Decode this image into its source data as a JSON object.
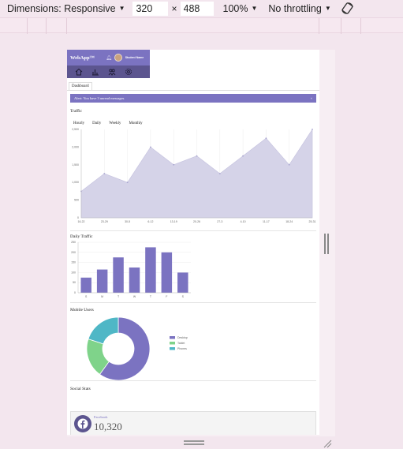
{
  "devtools": {
    "device": "Dimensions: Responsive",
    "width": "320",
    "times": "×",
    "height": "488",
    "zoom": "100%",
    "throttling": "No throttling"
  },
  "app": {
    "brand": "WebApp™",
    "user_name": "Student Name",
    "breadcrumb": "Dashboard",
    "alert_text": "Alert: You have 3 unread messages.",
    "alert_close": "×"
  },
  "traffic": {
    "title": "Traffic",
    "tabs": [
      "Hourly",
      "Daily",
      "Weekly",
      "Monthly"
    ]
  },
  "daily": {
    "title": "Daily Traffic"
  },
  "mobile": {
    "title": "Mobile Users"
  },
  "social": {
    "title": "Social Stats",
    "label": "Facebook",
    "value": "10,320"
  },
  "chart_data": [
    {
      "type": "area",
      "title": "",
      "y": [
        750,
        1250,
        1000,
        2000,
        1500,
        1750,
        1250,
        1750,
        2250,
        1500,
        2500
      ],
      "ylim": [
        0,
        2500
      ],
      "yticks": [
        "0",
        "500",
        "1,000",
        "1,500",
        "2,000",
        "2,500"
      ],
      "xticks": [
        "16-22",
        "23-29",
        "30-5",
        "6-12",
        "13-19",
        "20-26",
        "27-3",
        "4-10",
        "11-17",
        "18-24",
        "25-31"
      ],
      "fill": "#d5d3e8"
    },
    {
      "type": "bar",
      "title": "",
      "categories": [
        "S",
        "M",
        "T",
        "W",
        "T",
        "F",
        "S"
      ],
      "values": [
        75,
        115,
        175,
        125,
        225,
        200,
        100
      ],
      "ylim": [
        0,
        250
      ],
      "yticks": [
        "0",
        "50",
        "100",
        "150",
        "200",
        "250"
      ],
      "color": "#7b73c1"
    },
    {
      "type": "pie",
      "title": "",
      "labels": [
        "Desktop",
        "Tablet",
        "Phones"
      ],
      "values": [
        60,
        20,
        20
      ],
      "colors": [
        "#7b73c1",
        "#7fd38a",
        "#4fb7c6"
      ]
    }
  ]
}
